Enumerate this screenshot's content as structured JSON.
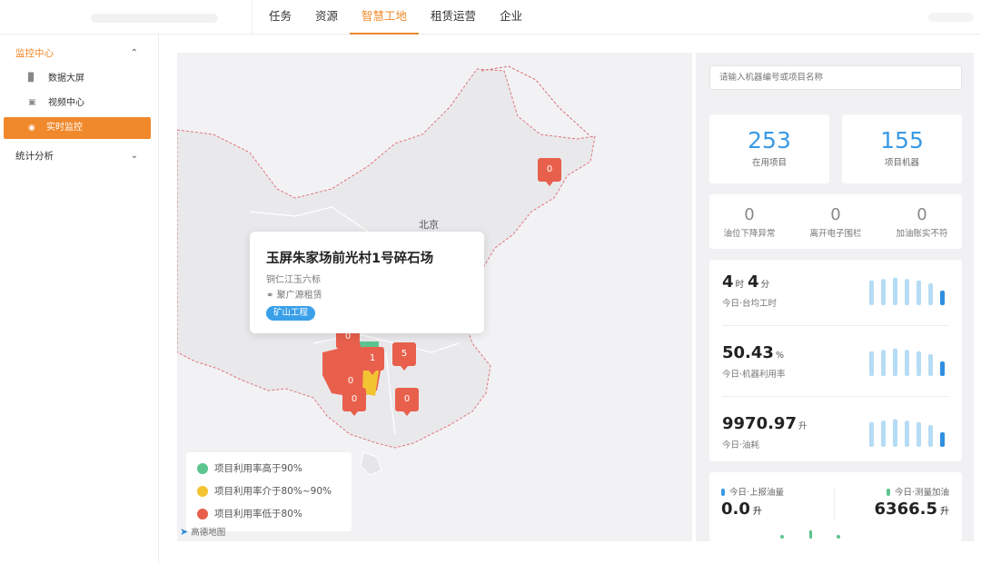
{
  "nav": {
    "items": [
      "任务",
      "资源",
      "智慧工地",
      "租赁运营",
      "企业"
    ],
    "active_index": 2
  },
  "sidebar": {
    "group1": {
      "label": "监控中心",
      "chevron": "^"
    },
    "items": [
      {
        "label": "数据大屏",
        "icon": "bar-chart-icon"
      },
      {
        "label": "视频中心",
        "icon": "video-icon"
      },
      {
        "label": "实时监控",
        "icon": "eye-icon",
        "active": true
      }
    ],
    "group2": {
      "label": "统计分析",
      "chevron": "v"
    }
  },
  "map": {
    "city_label": "北京",
    "markers": [
      "0",
      "0",
      "1",
      "5",
      "0",
      "0",
      "0"
    ],
    "popup": {
      "title": "玉屏朱家场前光村1号碎石场",
      "location": "铜仁江玉六标",
      "owner": "聚广源租赁",
      "tag": "矿山工程"
    },
    "legend": [
      {
        "label": "项目利用率高于90%",
        "color": "#5cc48e"
      },
      {
        "label": "项目利用率介于80%~90%",
        "color": "#f2c432"
      },
      {
        "label": "项目利用率低于80%",
        "color": "#e8604c"
      }
    ],
    "provider": "高德地图"
  },
  "panel": {
    "search_placeholder": "请输入机器编号或项目名称",
    "projects": {
      "value": "253",
      "label": "在用项目"
    },
    "machines": {
      "value": "155",
      "label": "项目机器"
    },
    "alarms": [
      {
        "value": "0",
        "label": "油位下降异常"
      },
      {
        "value": "0",
        "label": "离开电子围栏"
      },
      {
        "value": "0",
        "label": "加油账实不符"
      }
    ],
    "stats": [
      {
        "value_parts": [
          "4",
          "时",
          "4",
          "分"
        ],
        "label": "今日·台均工时",
        "bars": [
          0.85,
          0.9,
          0.95,
          0.9,
          0.85,
          0.75,
          0.5
        ]
      },
      {
        "value_parts": [
          "50.43",
          "%"
        ],
        "label": "今日·机器利用率",
        "bars": [
          0.85,
          0.9,
          0.95,
          0.9,
          0.85,
          0.75,
          0.5
        ]
      },
      {
        "value_parts": [
          "9970.97",
          "升"
        ],
        "label": "今日·油耗",
        "bars": [
          0.85,
          0.9,
          0.95,
          0.9,
          0.85,
          0.75,
          0.5
        ]
      }
    ],
    "oil": {
      "reported": {
        "label": "今日·上报油量",
        "value": "0.0",
        "unit": "升",
        "color": "#3a9ae4"
      },
      "measured": {
        "label": "今日·测量加油",
        "value": "6366.5",
        "unit": "升",
        "color": "#5cc48e"
      }
    }
  },
  "colors": {
    "accent": "#f0892b",
    "blue": "#3a9ae4",
    "marker": "#e8604c"
  }
}
